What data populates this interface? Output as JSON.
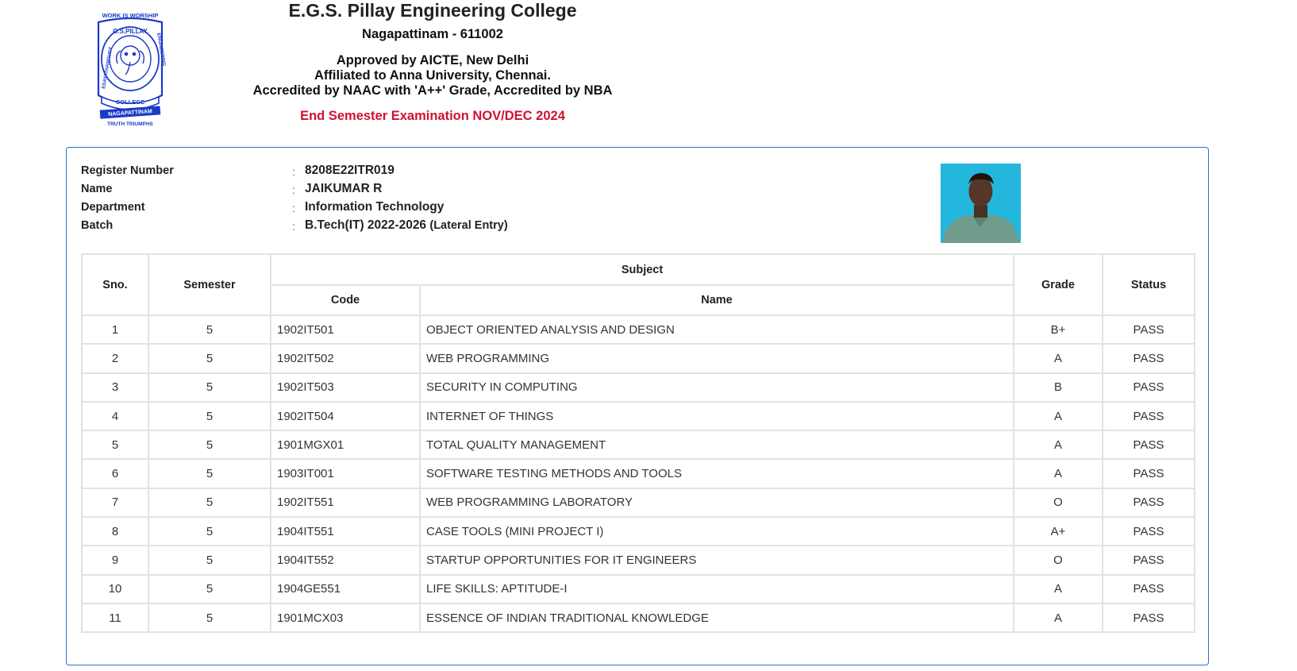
{
  "header": {
    "logo": {
      "top_text": "WORK IS WORSHIP",
      "ring_text_top": "G.S.PILLAY",
      "ring_left": "EDAYATHANGUDY",
      "ring_right": "ENGINEERING",
      "ribbon_college": "COLLEGE",
      "ribbon_place": "NAGAPATTINAM",
      "motto": "TRUTH TRIUMPHS"
    },
    "college_name": "E.G.S. Pillay Engineering College",
    "address": "Nagapattinam - 611002",
    "approval": "Approved by AICTE, New Delhi",
    "affiliation": "Affiliated to Anna University, Chennai.",
    "accreditation": "Accredited by NAAC with 'A++' Grade, Accredited by NBA",
    "exam_title": "End Semester Examination NOV/DEC 2024"
  },
  "student": {
    "register_label": "Register Number",
    "register_value": "8208E22ITR019",
    "name_label": "Name",
    "name_value": "JAIKUMAR R",
    "department_label": "Department",
    "department_value": "Information Technology",
    "batch_label": "Batch",
    "batch_value": "B.Tech(IT) 2022-2026",
    "batch_suffix": "(Lateral Entry)",
    "separator": ":"
  },
  "table": {
    "headers": {
      "sno": "Sno.",
      "semester": "Semester",
      "subject": "Subject",
      "code": "Code",
      "name": "Name",
      "grade": "Grade",
      "status": "Status"
    },
    "rows": [
      {
        "sno": "1",
        "semester": "5",
        "code": "1902IT501",
        "name": "OBJECT ORIENTED ANALYSIS AND DESIGN",
        "grade": "B+",
        "status": "PASS"
      },
      {
        "sno": "2",
        "semester": "5",
        "code": "1902IT502",
        "name": "WEB PROGRAMMING",
        "grade": "A",
        "status": "PASS"
      },
      {
        "sno": "3",
        "semester": "5",
        "code": "1902IT503",
        "name": "SECURITY IN COMPUTING",
        "grade": "B",
        "status": "PASS"
      },
      {
        "sno": "4",
        "semester": "5",
        "code": "1902IT504",
        "name": "INTERNET OF THINGS",
        "grade": "A",
        "status": "PASS"
      },
      {
        "sno": "5",
        "semester": "5",
        "code": "1901MGX01",
        "name": "TOTAL QUALITY MANAGEMENT",
        "grade": "A",
        "status": "PASS"
      },
      {
        "sno": "6",
        "semester": "5",
        "code": "1903IT001",
        "name": "SOFTWARE TESTING METHODS AND TOOLS",
        "grade": "A",
        "status": "PASS"
      },
      {
        "sno": "7",
        "semester": "5",
        "code": "1902IT551",
        "name": "WEB PROGRAMMING LABORATORY",
        "grade": "O",
        "status": "PASS"
      },
      {
        "sno": "8",
        "semester": "5",
        "code": "1904IT551",
        "name": "CASE TOOLS (MINI PROJECT I)",
        "grade": "A+",
        "status": "PASS"
      },
      {
        "sno": "9",
        "semester": "5",
        "code": "1904IT552",
        "name": "STARTUP OPPORTUNITIES FOR IT ENGINEERS",
        "grade": "O",
        "status": "PASS"
      },
      {
        "sno": "10",
        "semester": "5",
        "code": "1904GE551",
        "name": "LIFE SKILLS: APTITUDE-I",
        "grade": "A",
        "status": "PASS"
      },
      {
        "sno": "11",
        "semester": "5",
        "code": "1901MCX03",
        "name": "ESSENCE OF INDIAN TRADITIONAL KNOWLEDGE",
        "grade": "A",
        "status": "PASS"
      }
    ]
  },
  "colors": {
    "accent_border": "#2a6fd0",
    "logo_blue": "#1a3ac8",
    "exam_title": "#d21030",
    "photo_bg": "#24b7de"
  }
}
